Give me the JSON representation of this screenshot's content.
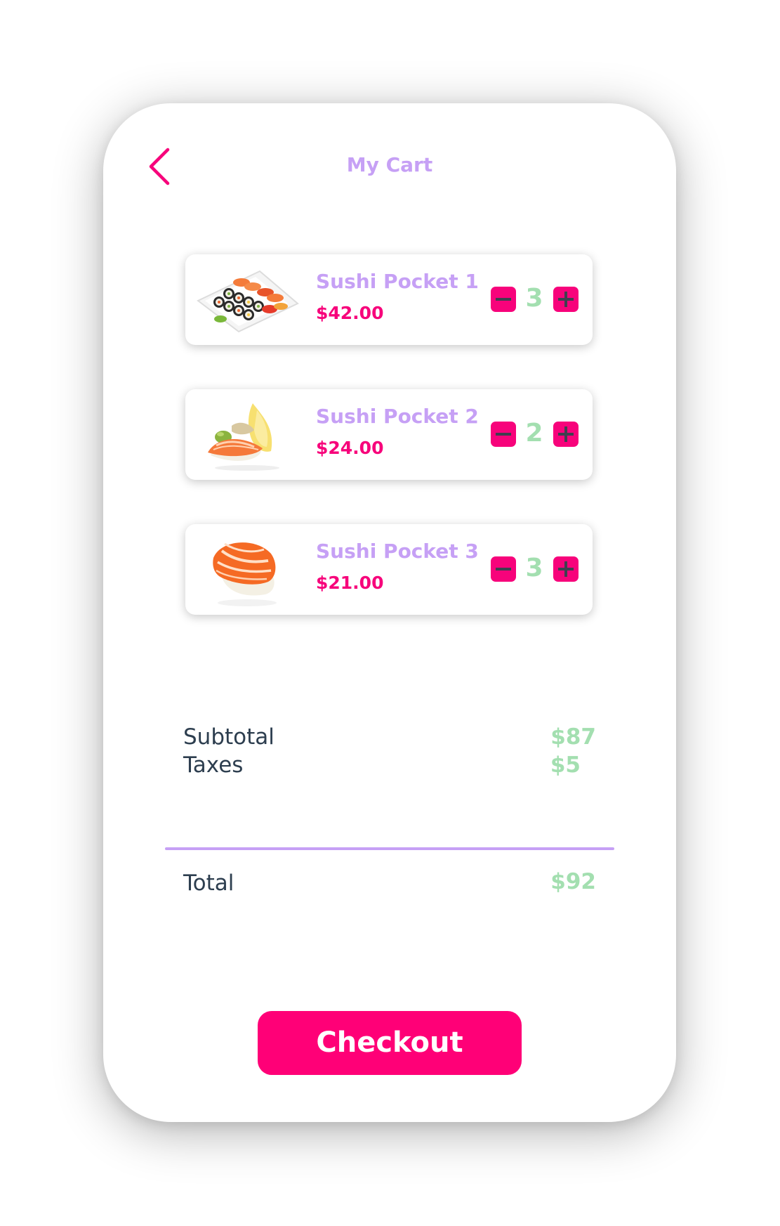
{
  "header": {
    "title": "My Cart",
    "back_icon": "chevron-left-icon"
  },
  "colors": {
    "accent_pink": "#ff0077",
    "title_purple": "#c6a0f5",
    "price_pink": "#f7037b",
    "value_green": "#a3dfb0",
    "text_dark": "#2d3e4f"
  },
  "cart": {
    "items": [
      {
        "name": "Sushi Pocket 1",
        "price": "$42.00",
        "quantity": "3",
        "image": "sushi-platter-image"
      },
      {
        "name": "Sushi Pocket 2",
        "price": "$24.00",
        "quantity": "2",
        "image": "salmon-nigiri-lemon-image"
      },
      {
        "name": "Sushi Pocket 3",
        "price": "$21.00",
        "quantity": "3",
        "image": "salmon-nigiri-image"
      }
    ],
    "minus_icon": "minus-icon",
    "plus_icon": "plus-icon"
  },
  "summary": {
    "subtotal_label": "Subtotal",
    "subtotal_value": "$87",
    "taxes_label": "Taxes",
    "taxes_value": "$5",
    "total_label": "Total",
    "total_value": "$92"
  },
  "checkout": {
    "label": "Checkout"
  }
}
